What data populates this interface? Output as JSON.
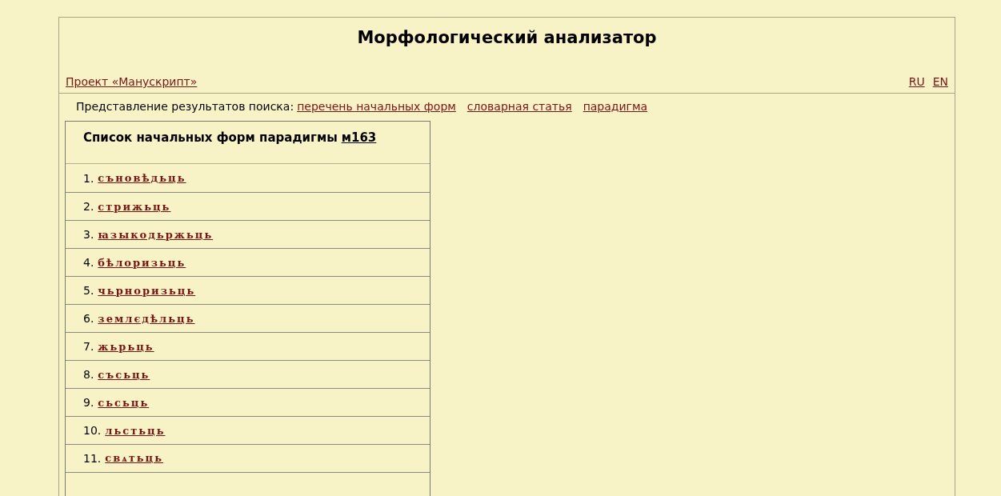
{
  "title": "Морфологический анализатор",
  "project_link": "Проект «Манускрипт»",
  "languages": [
    {
      "label": "RU",
      "selected": false
    },
    {
      "label": "EN",
      "selected": false
    }
  ],
  "view_label": "Представление результатов поиска:",
  "view_links": [
    "перечень начальных форм",
    "словарная статья",
    "парадигма"
  ],
  "list": {
    "heading": "Список начальных форм парадигмы",
    "paradigm_link": "м163",
    "items": [
      {
        "number": "1.",
        "word": "съновѣдьць"
      },
      {
        "number": "2.",
        "word": "стрижьць"
      },
      {
        "number": "3.",
        "word": "ꙗзыкодьржьць"
      },
      {
        "number": "4.",
        "word": "бѣлоризьць"
      },
      {
        "number": "5.",
        "word": "чьрноризьць"
      },
      {
        "number": "6.",
        "word": "землєдѣльць"
      },
      {
        "number": "7.",
        "word": "жьрьць"
      },
      {
        "number": "8.",
        "word": "съсьць"
      },
      {
        "number": "9.",
        "word": "сьсьць"
      },
      {
        "number": "10.",
        "word": "льстьць"
      },
      {
        "number": "11.",
        "word": "свѧтьць"
      }
    ]
  }
}
